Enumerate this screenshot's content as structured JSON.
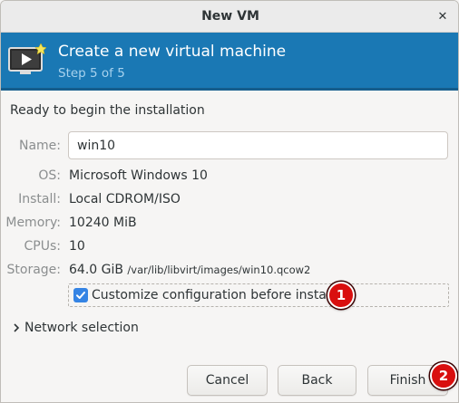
{
  "window": {
    "title": "New VM",
    "close_glyph": "✕"
  },
  "banner": {
    "heading": "Create a new virtual machine",
    "step": "Step 5 of 5",
    "icon": "virtual-machine-icon",
    "color": "#1a78b4"
  },
  "ready_text": "Ready to begin the installation",
  "fields": {
    "name": {
      "label": "Name:",
      "value": "win10"
    },
    "os": {
      "label": "OS:",
      "value": "Microsoft Windows 10"
    },
    "install": {
      "label": "Install:",
      "value": "Local CDROM/ISO"
    },
    "memory": {
      "label": "Memory:",
      "value": "10240 MiB"
    },
    "cpus": {
      "label": "CPUs:",
      "value": "10"
    },
    "storage": {
      "label": "Storage:",
      "value": "64.0 GiB",
      "path": "/var/lib/libvirt/images/win10.qcow2"
    }
  },
  "customize": {
    "label": "Customize configuration before install",
    "checked": true
  },
  "network": {
    "label": "Network selection",
    "expanded": false
  },
  "buttons": {
    "cancel": "Cancel",
    "back": "Back",
    "finish": "Finish"
  },
  "markers": [
    "1",
    "2"
  ],
  "colors": {
    "accent": "#3584e4",
    "marker": "#d90f0f"
  }
}
